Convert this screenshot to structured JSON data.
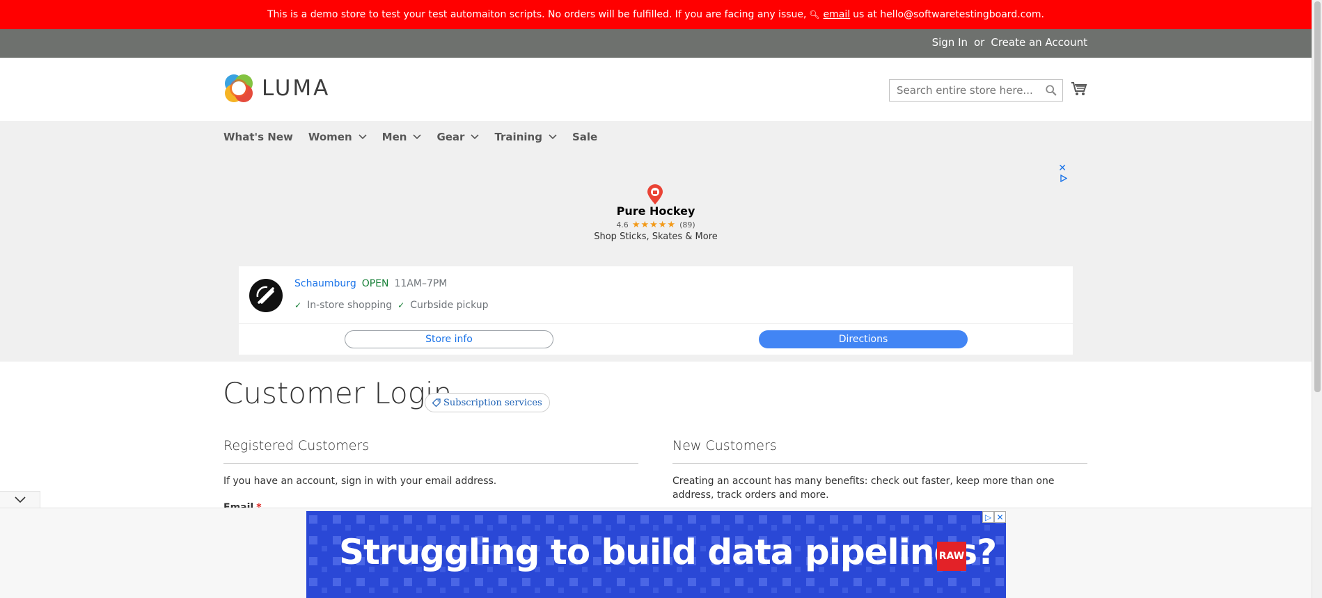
{
  "demo_notice": {
    "text_before": "This is a demo store to test your test automaiton scripts. No orders will be fulfilled. If you are facing any issue,",
    "link": "email",
    "text_after": "us at hello@softwaretestingboard.com."
  },
  "header": {
    "sign_in": "Sign In",
    "or": "or",
    "create_account": "Create an Account"
  },
  "logo": {
    "text": "LUMA"
  },
  "search": {
    "placeholder": "Search entire store here..."
  },
  "nav": {
    "items": [
      {
        "label": "What's New",
        "dropdown": false
      },
      {
        "label": "Women",
        "dropdown": true
      },
      {
        "label": "Men",
        "dropdown": true
      },
      {
        "label": "Gear",
        "dropdown": true
      },
      {
        "label": "Training",
        "dropdown": true
      },
      {
        "label": "Sale",
        "dropdown": false
      }
    ]
  },
  "ad_top": {
    "business": "Pure Hockey",
    "rating": "4.6",
    "stars": "★★★★★",
    "reviews": "(89)",
    "tagline": "Shop Sticks, Skates & More",
    "store": {
      "location": "Schaumburg",
      "status": "OPEN",
      "hours": "11AM–7PM",
      "feature1": "In-store shopping",
      "feature2": "Curbside pickup"
    },
    "btn_info": "Store info",
    "btn_directions": "Directions"
  },
  "page": {
    "title": "Customer Login",
    "badge": "Subscription services"
  },
  "registered": {
    "title": "Registered Customers",
    "text": "If you have an account, sign in with your email address.",
    "email_label": "Email",
    "required_mark": "*"
  },
  "new_customers": {
    "title": "New Customers",
    "text": "Creating an account has many benefits: check out faster, keep more than one address, track orders and more."
  },
  "ad_bottom": {
    "headline": "Struggling to build data pipelines?",
    "logo_text": "RAW"
  },
  "colors": {
    "notice_bg": "#ff0000",
    "header_bg": "#6e716e",
    "nav_bg": "#f0f0f0",
    "link_blue": "#1a73e8",
    "open_green": "#188038",
    "ad_blue": "#2a48d6",
    "raw_red": "#e32228"
  },
  "icons": [
    "key-icon",
    "search-icon",
    "cart-icon",
    "chevron-down-icon",
    "close-icon",
    "adchoices-icon",
    "map-pin-icon",
    "check-icon",
    "tag-icon"
  ]
}
